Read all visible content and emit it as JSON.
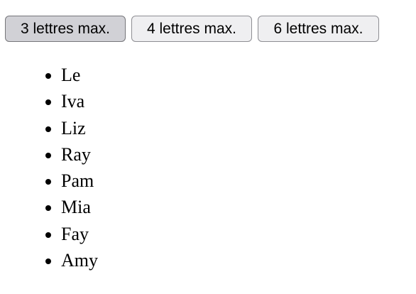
{
  "filters": {
    "buttons": [
      {
        "label": "3 lettres max.",
        "selected": true
      },
      {
        "label": "4 lettres max.",
        "selected": false
      },
      {
        "label": "6 lettres max.",
        "selected": false
      }
    ]
  },
  "names": {
    "items": [
      "Le",
      "Iva",
      "Liz",
      "Ray",
      "Pam",
      "Mia",
      "Fay",
      "Amy"
    ]
  }
}
